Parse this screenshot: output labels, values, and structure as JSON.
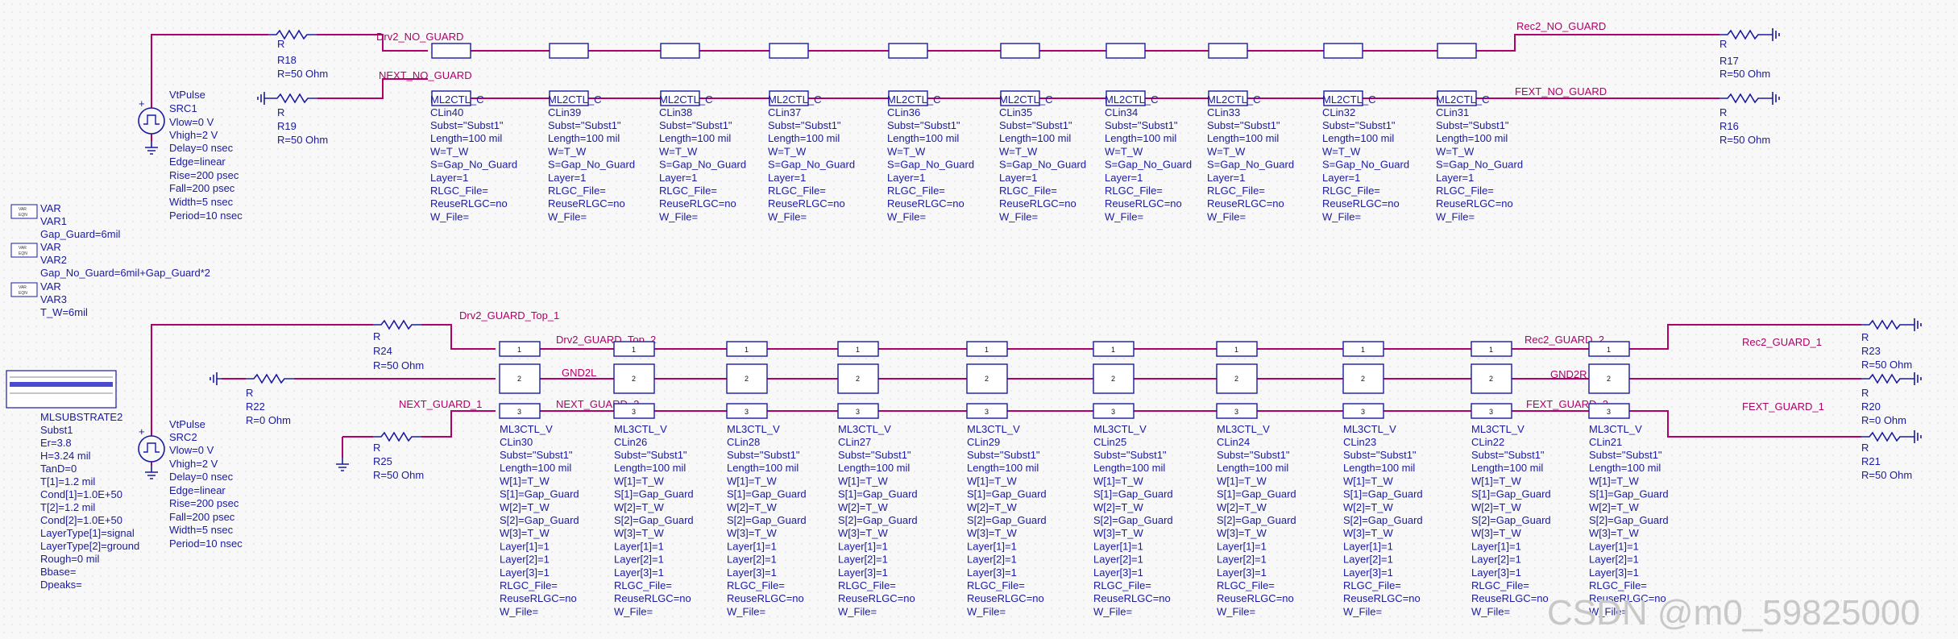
{
  "watermark": "CSDN @m0_59825000",
  "nets": {
    "drv2_no_guard": "Drv2_NO_GUARD",
    "next_no_guard": "NEXT_NO_GUARD",
    "rec2_no_guard": "Rec2_NO_GUARD",
    "fext_no_guard": "FEXT_NO_GUARD",
    "drv2_guard_top_1": "Drv2_GUARD_Top_1",
    "drv2_guard_top_2": "Drv2_GUARD_Top_2",
    "gnd2l": "GND2L",
    "gnd2r": "GND2R",
    "next_guard_1": "NEXT_GUARD_1",
    "next_guard_2": "NEXT_GUARD_2",
    "rec2_guard_2": "Rec2_GUARD_2",
    "rec2_guard_1": "Rec2_GUARD_1",
    "fext_guard_2": "FEXT_GUARD_2",
    "fext_guard_1": "FEXT_GUARD_1"
  },
  "resistors": [
    {
      "type": "R",
      "name": "R18",
      "value": "R=50 Ohm"
    },
    {
      "type": "R",
      "name": "R19",
      "value": "R=50 Ohm"
    },
    {
      "type": "R",
      "name": "R17",
      "value": "R=50 Ohm"
    },
    {
      "type": "R",
      "name": "R16",
      "value": "R=50 Ohm"
    },
    {
      "type": "R",
      "name": "R24",
      "value": "R=50 Ohm"
    },
    {
      "type": "R",
      "name": "R22",
      "value": "R=0 Ohm"
    },
    {
      "type": "R",
      "name": "R25",
      "value": "R=50 Ohm"
    },
    {
      "type": "R",
      "name": "R23",
      "value": "R=50 Ohm"
    },
    {
      "type": "R",
      "name": "R20",
      "value": "R=0 Ohm"
    },
    {
      "type": "R",
      "name": "R21",
      "value": "R=50 Ohm"
    }
  ],
  "sources": [
    {
      "lines": [
        "VtPulse",
        "SRC1",
        "Vlow=0 V",
        "Vhigh=2 V",
        "Delay=0 nsec",
        "Edge=linear",
        "Rise=200 psec",
        "Fall=200 psec",
        "Width=5 nsec",
        "Period=10 nsec"
      ]
    },
    {
      "lines": [
        "VtPulse",
        "SRC2",
        "Vlow=0 V",
        "Vhigh=2 V",
        "Delay=0 nsec",
        "Edge=linear",
        "Rise=200 psec",
        "Fall=200 psec",
        "Width=5 nsec",
        "Period=10 nsec"
      ]
    }
  ],
  "vars": [
    {
      "icon_top": "VAR",
      "icon_bottom": "EQN",
      "lines": [
        "VAR",
        "VAR1",
        "Gap_Guard=6mil"
      ]
    },
    {
      "icon_top": "VAR",
      "icon_bottom": "EQN",
      "lines": [
        "VAR",
        "VAR2",
        "Gap_No_Guard=6mil+Gap_Guard*2"
      ]
    },
    {
      "icon_top": "VAR",
      "icon_bottom": "EQN",
      "lines": [
        "VAR",
        "VAR3",
        "T_W=6mil"
      ]
    }
  ],
  "substrate": {
    "lines": [
      "MLSUBSTRATE2",
      "Subst1",
      "Er=3.8",
      "H=3.24 mil",
      "TanD=0",
      "T[1]=1.2 mil",
      "Cond[1]=1.0E+50",
      "T[2]=1.2 mil",
      "Cond[2]=1.0E+50",
      "LayerType[1]=signal",
      "LayerType[2]=ground",
      "Rough=0 mil",
      "Bbase=",
      "Dpeaks="
    ]
  },
  "ml2ctl": {
    "type": "ML2CTL_C",
    "names": [
      "CLin40",
      "CLin39",
      "CLin38",
      "CLin37",
      "CLin36",
      "CLin35",
      "CLin34",
      "CLin33",
      "CLin32",
      "CLin31"
    ],
    "params": [
      "Subst=\"Subst1\"",
      "Length=100 mil",
      "W=T_W",
      "S=Gap_No_Guard",
      "Layer=1",
      "RLGC_File=",
      "ReuseRLGC=no",
      "W_File="
    ]
  },
  "ml3ctl": {
    "type": "ML3CTL_V",
    "names": [
      "CLin30",
      "CLin26",
      "CLin28",
      "CLin27",
      "CLin29",
      "CLin25",
      "CLin24",
      "CLin23",
      "CLin22",
      "CLin21"
    ],
    "params": [
      "Subst=\"Subst1\"",
      "Length=100 mil",
      "W[1]=T_W",
      "S[1]=Gap_Guard",
      "W[2]=T_W",
      "S[2]=Gap_Guard",
      "W[3]=T_W",
      "Layer[1]=1",
      "Layer[2]=1",
      "Layer[3]=1",
      "RLGC_File=",
      "ReuseRLGC=no",
      "W_File="
    ],
    "pin_labels": [
      "1",
      "2",
      "3"
    ]
  }
}
